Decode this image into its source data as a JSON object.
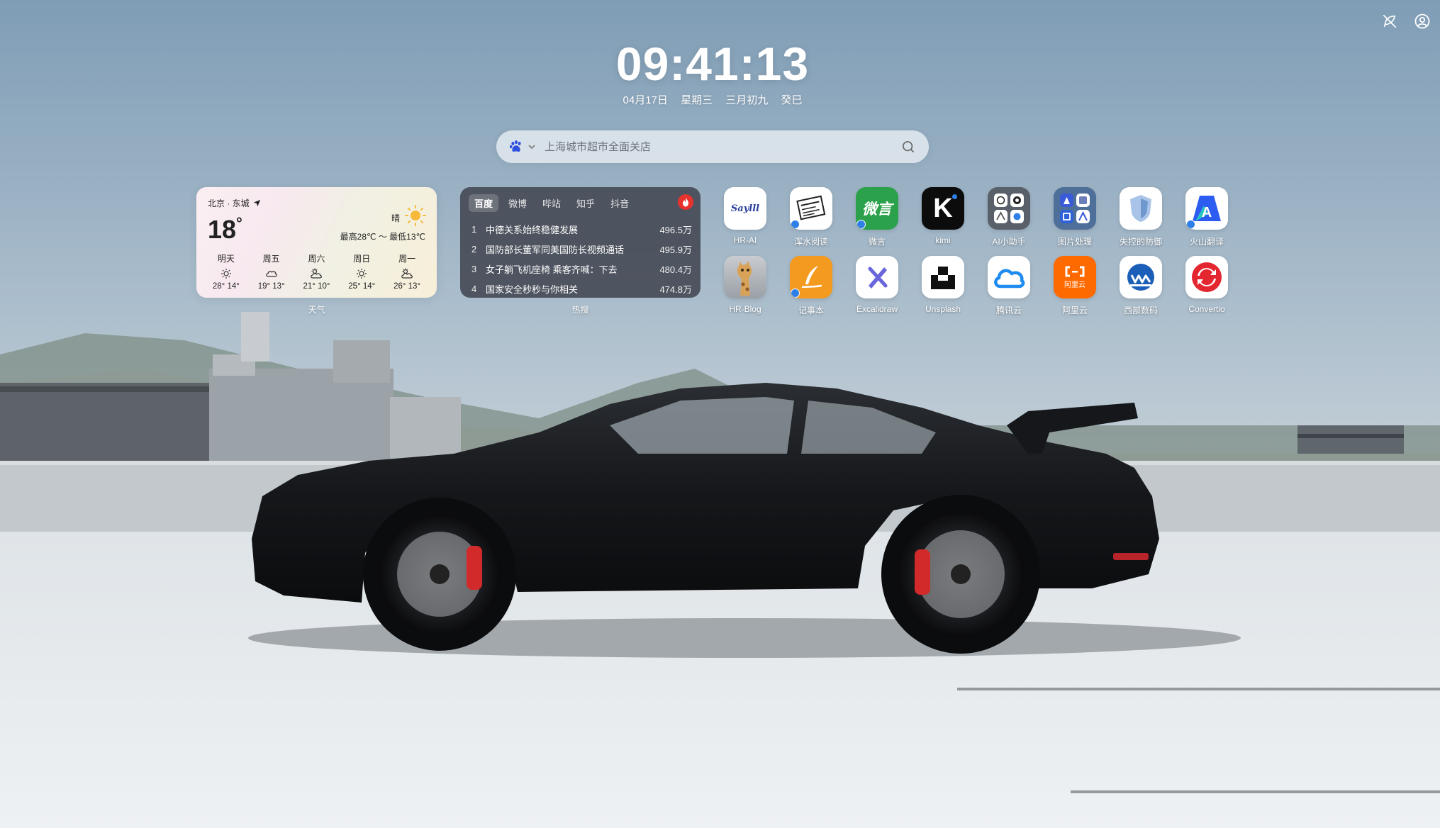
{
  "top_right": {
    "icons": [
      "feather-off-icon",
      "user-circle-icon"
    ]
  },
  "clock": {
    "time": "09:41:13"
  },
  "date": {
    "solar": "04月17日",
    "weekday": "星期三",
    "lunar": "三月初九",
    "ganzhi": "癸巳"
  },
  "search": {
    "engine_icon": "baidu-paw-icon",
    "placeholder": "上海城市超市全面关店"
  },
  "weather": {
    "location": "北京 · 东城",
    "temp": "18",
    "condition": "晴",
    "range": "最高28℃ ～ 最低13℃",
    "forecast": [
      {
        "day": "明天",
        "icon": "sun-icon",
        "temps": "28° 14°"
      },
      {
        "day": "周五",
        "icon": "cloud-icon",
        "temps": "19° 13°"
      },
      {
        "day": "周六",
        "icon": "partly-cloudy-icon",
        "temps": "21° 10°"
      },
      {
        "day": "周日",
        "icon": "sun-icon",
        "temps": "25° 14°"
      },
      {
        "day": "周一",
        "icon": "partly-cloudy-icon",
        "temps": "26° 13°"
      }
    ],
    "label": "天气"
  },
  "hot": {
    "tabs": [
      "百度",
      "微博",
      "哔站",
      "知乎",
      "抖音"
    ],
    "active_tab": "百度",
    "items": [
      {
        "rank": "1",
        "title": "中德关系始终稳健发展",
        "heat": "496.5万"
      },
      {
        "rank": "2",
        "title": "国防部长董军同美国防长视频通话",
        "heat": "495.9万"
      },
      {
        "rank": "3",
        "title": "女子躺飞机座椅 乘客齐喊：下去",
        "heat": "480.4万"
      },
      {
        "rank": "4",
        "title": "国家安全秒秒与你相关",
        "heat": "474.8万"
      }
    ],
    "label": "热搜"
  },
  "apps": [
    {
      "label": "HR-AI",
      "tile_text": "Saylll"
    },
    {
      "label": "浑水阅读",
      "tile_text": ""
    },
    {
      "label": "微言",
      "tile_text": "微言"
    },
    {
      "label": "kimi",
      "tile_text": "K"
    },
    {
      "label": "AI小助手",
      "tile_text": ""
    },
    {
      "label": "图片处理",
      "tile_text": ""
    },
    {
      "label": "失控的防御",
      "tile_text": ""
    },
    {
      "label": "火山翻译",
      "tile_text": "A"
    },
    {
      "label": "HR-Blog",
      "tile_text": ""
    },
    {
      "label": "记事本",
      "tile_text": ""
    },
    {
      "label": "Excalidraw",
      "tile_text": ""
    },
    {
      "label": "Unsplash",
      "tile_text": ""
    },
    {
      "label": "腾讯云",
      "tile_text": ""
    },
    {
      "label": "阿里云",
      "tile_text": "阿里云"
    },
    {
      "label": "西部数码",
      "tile_text": ""
    },
    {
      "label": "Convertio",
      "tile_text": ""
    }
  ]
}
